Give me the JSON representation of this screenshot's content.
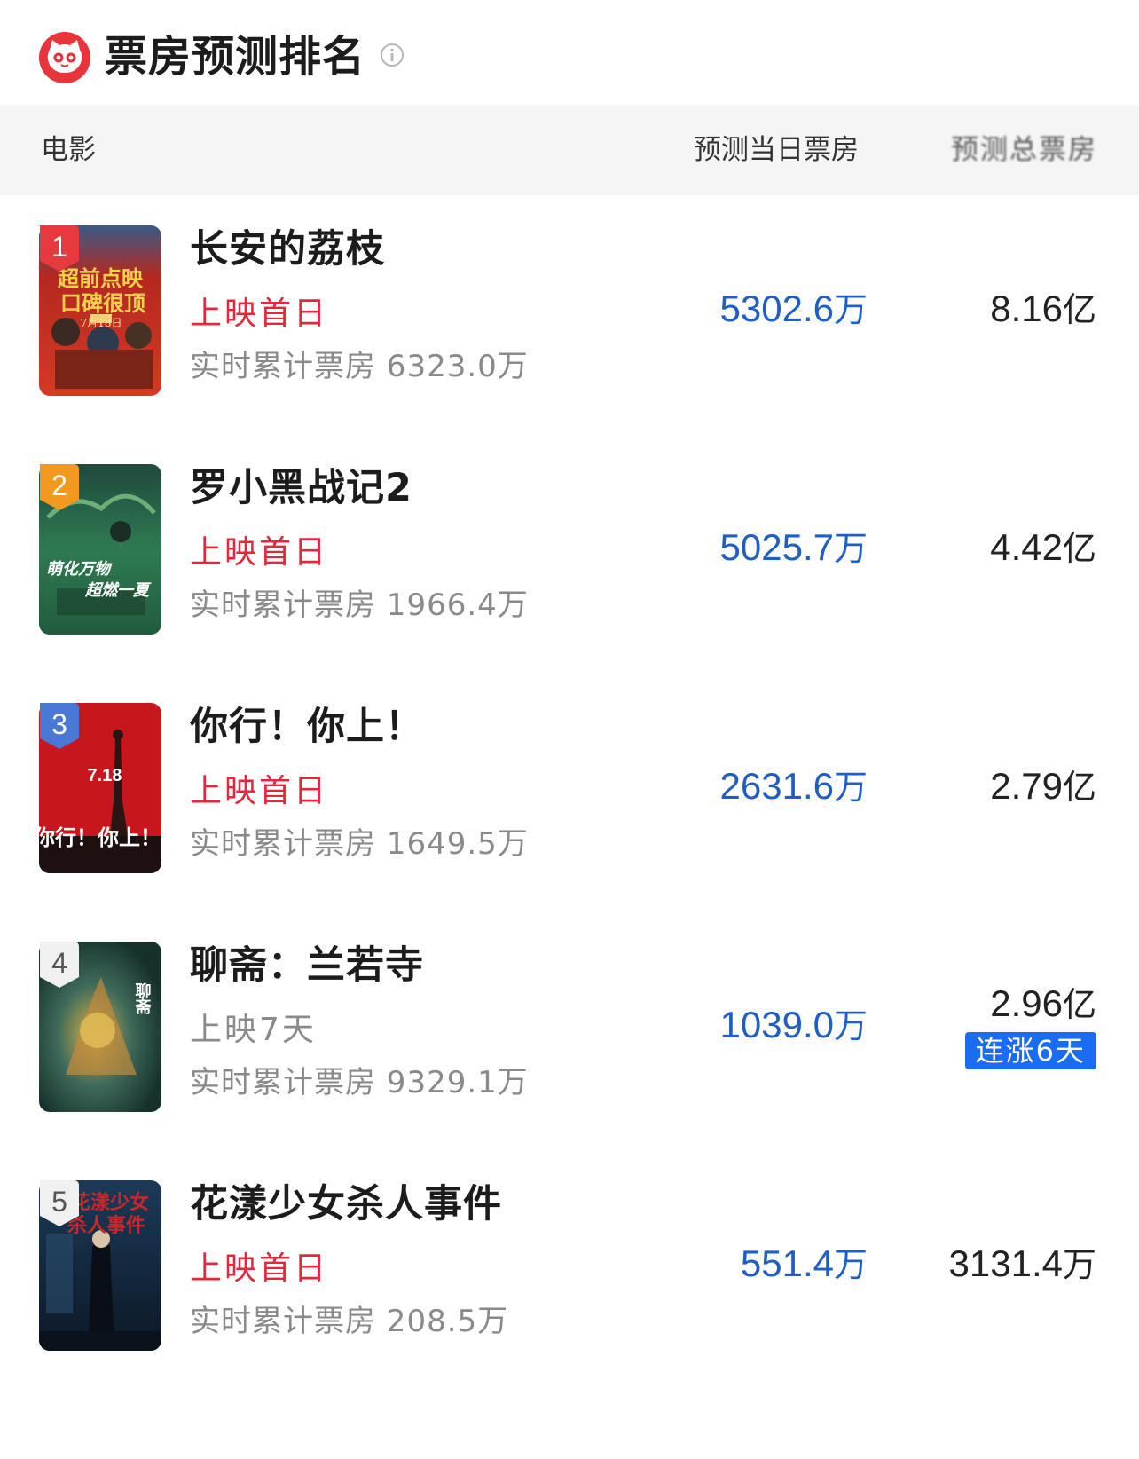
{
  "header": {
    "title": "票房预测排名"
  },
  "columns": {
    "movie": "电影",
    "predicted_day": "预测当日票房",
    "predicted_total": "预测总票房"
  },
  "movies": [
    {
      "rank": "1",
      "title": "长安的荔枝",
      "status": "上映首日",
      "cumulative": "实时累计票房 6323.0万",
      "predicted_day": "5302.6",
      "predicted_day_unit": "万",
      "predicted_total": "8.16",
      "predicted_total_unit": "亿",
      "poster_text": [
        "超前点映",
        "口碑很顶",
        "7月18日"
      ]
    },
    {
      "rank": "2",
      "title": "罗小黑战记2",
      "status": "上映首日",
      "cumulative": "实时累计票房 1966.4万",
      "predicted_day": "5025.7",
      "predicted_day_unit": "万",
      "predicted_total": "4.42",
      "predicted_total_unit": "亿",
      "poster_text": [
        "萌化万物",
        "超燃一夏"
      ]
    },
    {
      "rank": "3",
      "title": "你行！你上！",
      "status": "上映首日",
      "cumulative": "实时累计票房 1649.5万",
      "predicted_day": "2631.6",
      "predicted_day_unit": "万",
      "predicted_total": "2.79",
      "predicted_total_unit": "亿",
      "poster_text": [
        "7.18",
        "你行！你上！"
      ]
    },
    {
      "rank": "4",
      "title": "聊斋：兰若寺",
      "status": "上映7天",
      "cumulative": "实时累计票房 9329.1万",
      "predicted_day": "1039.0",
      "predicted_day_unit": "万",
      "predicted_total": "2.96",
      "predicted_total_unit": "亿",
      "badge": "连涨6天",
      "poster_text": [
        "聊斋"
      ]
    },
    {
      "rank": "5",
      "title": "花漾少女杀人事件",
      "status": "上映首日",
      "cumulative": "实时累计票房 208.5万",
      "predicted_day": "551.4",
      "predicted_day_unit": "万",
      "predicted_total": "3131.4",
      "predicted_total_unit": "万",
      "poster_text": [
        "花漾少女",
        "杀人事件"
      ]
    }
  ],
  "colors": {
    "brand_red": "#e8343b",
    "status_red": "#e5273c",
    "value_blue": "#1f5fc4",
    "badge_blue": "#1a6cf2",
    "rank_gold": "#f39a1e",
    "rank_blue": "#4a78d6"
  },
  "icons": {
    "logo": "maoyan-cat-logo",
    "info": "info-icon"
  }
}
